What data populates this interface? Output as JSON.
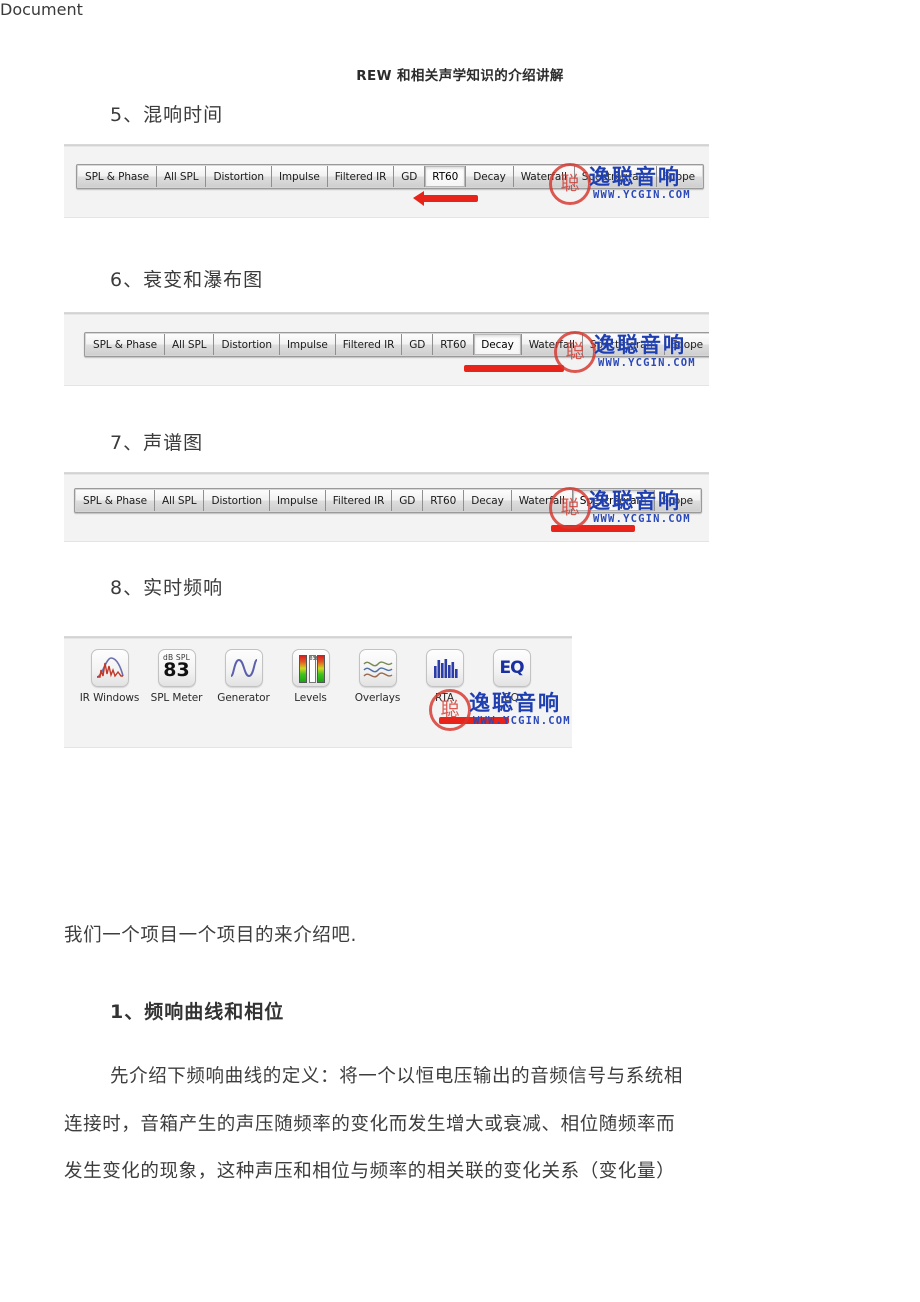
{
  "document": {
    "header_title": "REW 和相关声学知识的介绍讲解"
  },
  "sections": [
    {
      "heading": "5、混响时间",
      "selected_tab": "RT60",
      "tabs": [
        "SPL & Phase",
        "All SPL",
        "Distortion",
        "Impulse",
        "Filtered IR",
        "GD",
        "RT60",
        "Decay",
        "Waterfall",
        "Spectrogram",
        "Scope"
      ]
    },
    {
      "heading": "6、衰变和瀑布图",
      "selected_tab": "Decay",
      "tabs": [
        "SPL & Phase",
        "All SPL",
        "Distortion",
        "Impulse",
        "Filtered IR",
        "GD",
        "RT60",
        "Decay",
        "Waterfall",
        "Spectrogram",
        "Scope"
      ]
    },
    {
      "heading": "7、声谱图",
      "selected_tab": "Spectrogram",
      "tabs": [
        "SPL & Phase",
        "All SPL",
        "Distortion",
        "Impulse",
        "Filtered IR",
        "GD",
        "RT60",
        "Decay",
        "Waterfall",
        "Spectrogram",
        "Scope"
      ]
    },
    {
      "heading": "8、实时频响",
      "toolbar": [
        {
          "label": "IR Windows",
          "icon": "ir-windows-icon"
        },
        {
          "label": "SPL Meter",
          "icon": "spl-meter-icon",
          "unit": "dB SPL",
          "value": "83"
        },
        {
          "label": "Generator",
          "icon": "generator-icon"
        },
        {
          "label": "Levels",
          "icon": "levels-icon",
          "scale": "0369"
        },
        {
          "label": "Overlays",
          "icon": "overlays-icon"
        },
        {
          "label": "RTA",
          "icon": "rta-icon"
        },
        {
          "label": "EQ",
          "icon": "eq-icon",
          "glyph": "EQ"
        }
      ]
    }
  ],
  "watermark": {
    "brand_cn": "逸聪音响",
    "url": "WWW.YCGIN.COM",
    "seal_glyph": "聪",
    "brand_color": "#1f3fb0",
    "seal_color": "#d6372e"
  },
  "annotation": {
    "marker_color": "#e8241a"
  },
  "body": {
    "intro": "我们一个项目一个项目的来介绍吧.",
    "subheading": "1、频响曲线和相位",
    "paragraph_lines": [
      "先介绍下频响曲线的定义：将一个以恒电压输出的音频信号与系统相",
      "连接时，音箱产生的声压随频率的变化而发生增大或衰减、相位随频率而",
      "发生变化的现象，这种声压和相位与频率的相关联的变化关系（变化量）"
    ]
  }
}
